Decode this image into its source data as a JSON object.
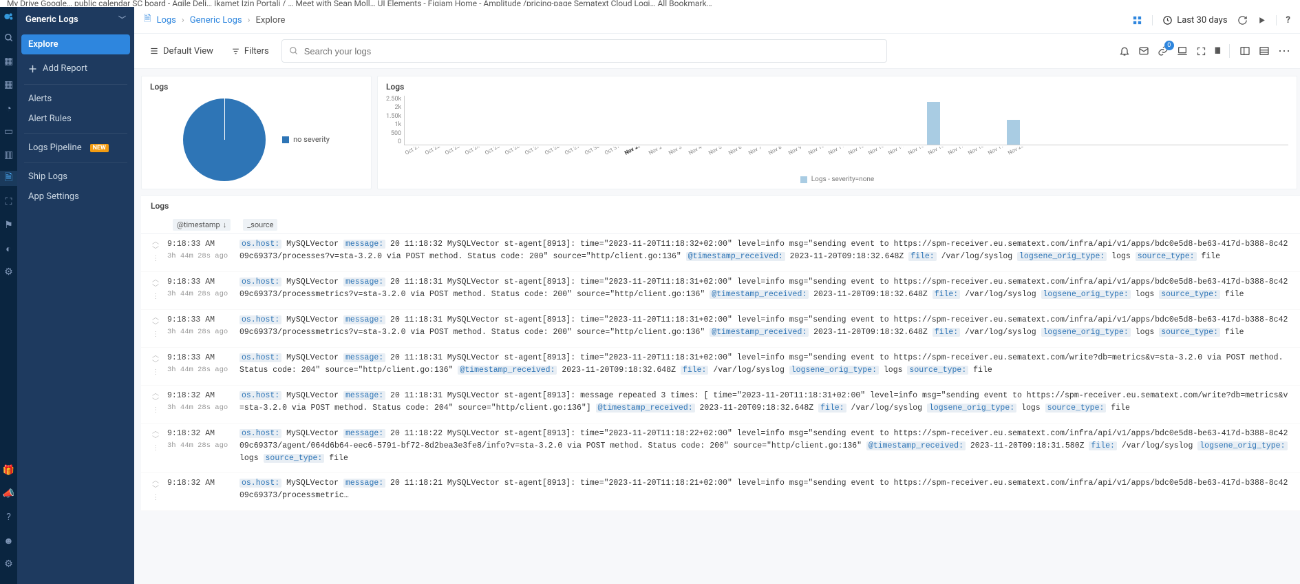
{
  "bookmarks_hint": "My Drive  Google…   public calendar   SC board - Agile Deli…   Ikamet Izin Portali / …   Meet with Sean Moll…   UI Elements - Figjam   Home - Amplitude   /pricing-page   Sematext Cloud Logi…        All Bookmark…",
  "sidebar": {
    "title": "Generic Logs",
    "explore": "Explore",
    "add_report": "Add Report",
    "alerts": "Alerts",
    "alert_rules": "Alert Rules",
    "logs_pipeline": "Logs Pipeline",
    "new_badge": "NEW",
    "ship_logs": "Ship Logs",
    "app_settings": "App Settings"
  },
  "breadcrumb": {
    "logs": "Logs",
    "app": "Generic Logs",
    "page": "Explore",
    "timerange": "Last 30 days"
  },
  "toolbar": {
    "default_view": "Default View",
    "filters": "Filters",
    "search_placeholder": "Search your logs",
    "link_badge": "0"
  },
  "pie_panel": {
    "title": "Logs",
    "legend": "no severity"
  },
  "chart_data": {
    "type": "bar",
    "title": "Logs",
    "ylabel": "",
    "xlabel": "",
    "ylim": [
      0,
      2500
    ],
    "y_ticks": [
      "2.50k",
      "2k",
      "1.50k",
      "1k",
      "500",
      "0"
    ],
    "categories": [
      "Oct 21",
      "Oct 22",
      "Oct 23",
      "Oct 24",
      "Oct 25",
      "Oct 26",
      "Oct 27",
      "Oct 28",
      "Oct 29",
      "Oct 30",
      "Oct 31",
      "Nov 2023",
      "Nov 2",
      "Nov 3",
      "Nov 4",
      "Nov 5",
      "Nov 6",
      "Nov 7",
      "Nov 8",
      "Nov 9",
      "Nov 10",
      "Nov 11",
      "Nov 12",
      "Nov 13",
      "Nov 14",
      "Nov 15",
      "Nov 16",
      "Nov 17",
      "Nov 18",
      "Nov 19",
      "Nov 20"
    ],
    "bold_index": 11,
    "values": [
      0,
      0,
      0,
      0,
      0,
      0,
      0,
      0,
      0,
      0,
      0,
      0,
      0,
      0,
      0,
      0,
      0,
      0,
      0,
      0,
      0,
      0,
      0,
      0,
      0,
      0,
      2150,
      0,
      0,
      0,
      1250
    ],
    "legend": "Logs - severity=none"
  },
  "logs_table": {
    "title": "Logs",
    "columns": {
      "timestamp": "@timestamp",
      "source": "_source",
      "sort_arrow": "↓"
    },
    "rows": [
      {
        "time": "9:18:33 AM",
        "ago": "3h 44m 28s ago",
        "fields": [
          {
            "k": "os.host:",
            "v": " MySQLVector "
          },
          {
            "k": "message:",
            "v": " 20 11:18:32 MySQLVector st-agent[8913]: time=\"2023-11-20T11:18:32+02:00\" level=info msg=\"sending event to https://spm-receiver.eu.sematext.com/infra/api/v1/apps/bdc0e5d8-be63-417d-b388-8c4209c69373/processes?v=sta-3.2.0 via POST method. Status code: 200\" source=\"http/client.go:136\" "
          },
          {
            "k": "@timestamp_received:",
            "v": " 2023-11-20T09:18:32.648Z "
          },
          {
            "k": "file:",
            "v": " /var/log/syslog "
          },
          {
            "k": "logsene_orig_type:",
            "v": " logs "
          },
          {
            "k": "source_type:",
            "v": " file"
          }
        ]
      },
      {
        "time": "9:18:33 AM",
        "ago": "3h 44m 28s ago",
        "fields": [
          {
            "k": "os.host:",
            "v": " MySQLVector "
          },
          {
            "k": "message:",
            "v": " 20 11:18:31 MySQLVector st-agent[8913]: time=\"2023-11-20T11:18:31+02:00\" level=info msg=\"sending event to https://spm-receiver.eu.sematext.com/infra/api/v1/apps/bdc0e5d8-be63-417d-b388-8c4209c69373/processmetrics?v=sta-3.2.0 via POST method. Status code: 200\" source=\"http/client.go:136\" "
          },
          {
            "k": "@timestamp_received:",
            "v": " 2023-11-20T09:18:32.648Z "
          },
          {
            "k": "file:",
            "v": " /var/log/syslog "
          },
          {
            "k": "logsene_orig_type:",
            "v": " logs "
          },
          {
            "k": "source_type:",
            "v": " file"
          }
        ]
      },
      {
        "time": "9:18:33 AM",
        "ago": "3h 44m 28s ago",
        "fields": [
          {
            "k": "os.host:",
            "v": " MySQLVector "
          },
          {
            "k": "message:",
            "v": " 20 11:18:31 MySQLVector st-agent[8913]: time=\"2023-11-20T11:18:31+02:00\" level=info msg=\"sending event to https://spm-receiver.eu.sematext.com/infra/api/v1/apps/bdc0e5d8-be63-417d-b388-8c4209c69373/processmetrics?v=sta-3.2.0 via POST method. Status code: 200\" source=\"http/client.go:136\" "
          },
          {
            "k": "@timestamp_received:",
            "v": " 2023-11-20T09:18:32.648Z "
          },
          {
            "k": "file:",
            "v": " /var/log/syslog "
          },
          {
            "k": "logsene_orig_type:",
            "v": " logs "
          },
          {
            "k": "source_type:",
            "v": " file"
          }
        ]
      },
      {
        "time": "9:18:33 AM",
        "ago": "3h 44m 28s ago",
        "fields": [
          {
            "k": "os.host:",
            "v": " MySQLVector "
          },
          {
            "k": "message:",
            "v": " 20 11:18:31 MySQLVector st-agent[8913]: time=\"2023-11-20T11:18:31+02:00\" level=info msg=\"sending event to https://spm-receiver.eu.sematext.com/write?db=metrics&v=sta-3.2.0 via POST method. Status code: 204\" source=\"http/client.go:136\" "
          },
          {
            "k": "@timestamp_received:",
            "v": " 2023-11-20T09:18:32.648Z "
          },
          {
            "k": "file:",
            "v": " /var/log/syslog "
          },
          {
            "k": "logsene_orig_type:",
            "v": " logs "
          },
          {
            "k": "source_type:",
            "v": " file"
          }
        ]
      },
      {
        "time": "9:18:32 AM",
        "ago": "3h 44m 28s ago",
        "fields": [
          {
            "k": "os.host:",
            "v": " MySQLVector "
          },
          {
            "k": "message:",
            "v": " 20 11:18:31 MySQLVector st-agent[8913]: message repeated 3 times: [ time=\"2023-11-20T11:18:31+02:00\" level=info msg=\"sending event to https://spm-receiver.eu.sematext.com/write?db=metrics&v=sta-3.2.0 via POST method. Status code: 204\" source=\"http/client.go:136\"] "
          },
          {
            "k": "@timestamp_received:",
            "v": " 2023-11-20T09:18:32.648Z "
          },
          {
            "k": "file:",
            "v": " /var/log/syslog "
          },
          {
            "k": "logsene_orig_type:",
            "v": " logs "
          },
          {
            "k": "source_type:",
            "v": " file"
          }
        ]
      },
      {
        "time": "9:18:32 AM",
        "ago": "3h 44m 28s ago",
        "fields": [
          {
            "k": "os.host:",
            "v": " MySQLVector "
          },
          {
            "k": "message:",
            "v": " 20 11:18:22 MySQLVector st-agent[8913]: time=\"2023-11-20T11:18:22+02:00\" level=info msg=\"sending event to https://spm-receiver.eu.sematext.com/infra/api/v1/apps/bdc0e5d8-be63-417d-b388-8c4209c69373/agent/064d6b64-eec6-5791-bf72-8d2bea3e3fe8/info?v=sta-3.2.0 via POST method. Status code: 200\" source=\"http/client.go:136\" "
          },
          {
            "k": "@timestamp_received:",
            "v": " 2023-11-20T09:18:31.580Z "
          },
          {
            "k": "file:",
            "v": " /var/log/syslog "
          },
          {
            "k": "logsene_orig_type:",
            "v": " logs "
          },
          {
            "k": "source_type:",
            "v": " file"
          }
        ]
      },
      {
        "time": "9:18:32 AM",
        "ago": "",
        "fields": [
          {
            "k": "os.host:",
            "v": " MySQLVector "
          },
          {
            "k": "message:",
            "v": " 20 11:18:21 MySQLVector st-agent[8913]: time=\"2023-11-20T11:18:21+02:00\" level=info msg=\"sending event to https://spm-receiver.eu.sematext.com/infra/api/v1/apps/bdc0e5d8-be63-417d-b388-8c4209c69373/processmetric…"
          }
        ]
      }
    ]
  }
}
